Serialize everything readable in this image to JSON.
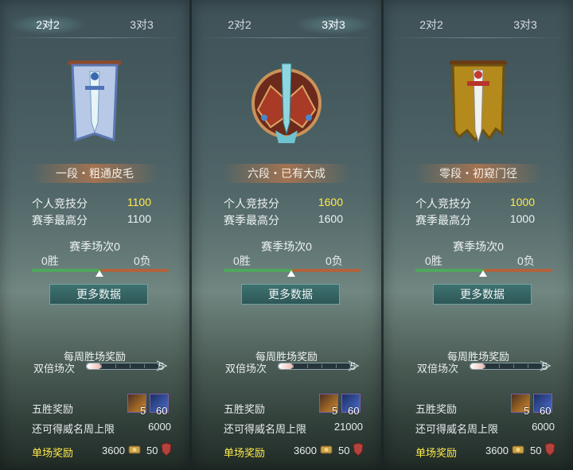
{
  "panels": [
    {
      "tabs": [
        "2对2",
        "3对3"
      ],
      "active_tab": 0,
      "emblem": "blue-banner-sword-icon",
      "rank_title": "一段・粗通皮毛",
      "personal_score_label": "个人竞技分",
      "personal_score": "1100",
      "season_high_label": "赛季最高分",
      "season_high": "1100",
      "season_matches": "赛季场次0",
      "wins": "0胜",
      "losses": "0负",
      "more_button": "更多数据",
      "weekly_reward": "每周胜场奖励",
      "double_label": "双倍场次",
      "double_count": "5",
      "five_win_label": "五胜奖励",
      "item1_count": "5",
      "item2_count": "60",
      "cap_label": "还可得威名周上限",
      "cap_value": "6000",
      "single_label": "单场奖励",
      "single_val1": "3600",
      "single_val2": "50"
    },
    {
      "tabs": [
        "2对2",
        "3对3"
      ],
      "active_tab": 1,
      "emblem": "ornate-crest-sword-icon",
      "rank_title": "六段・已有大成",
      "personal_score_label": "个人竞技分",
      "personal_score": "1600",
      "season_high_label": "赛季最高分",
      "season_high": "1600",
      "season_matches": "赛季场次0",
      "wins": "0胜",
      "losses": "0负",
      "more_button": "更多数据",
      "weekly_reward": "每周胜场奖励",
      "double_label": "双倍场次",
      "double_count": "5",
      "five_win_label": "五胜奖励",
      "item1_count": "5",
      "item2_count": "60",
      "cap_label": "还可得威名周上限",
      "cap_value": "21000",
      "single_label": "单场奖励",
      "single_val1": "3600",
      "single_val2": "50"
    },
    {
      "tabs": [
        "2对2",
        "3对3"
      ],
      "active_tab": -1,
      "emblem": "tattered-gold-banner-sword-icon",
      "rank_title": "零段・初窥门径",
      "personal_score_label": "个人竞技分",
      "personal_score": "1000",
      "season_high_label": "赛季最高分",
      "season_high": "1000",
      "season_matches": "赛季场次0",
      "wins": "0胜",
      "losses": "0负",
      "more_button": "更多数据",
      "weekly_reward": "每周胜场奖励",
      "double_label": "双倍场次",
      "double_count": "5",
      "five_win_label": "五胜奖励",
      "item1_count": "5",
      "item2_count": "60",
      "cap_label": "还可得威名周上限",
      "cap_value": "6000",
      "single_label": "单场奖励",
      "single_val1": "3600",
      "single_val2": "50"
    }
  ],
  "colors": {
    "highlight": "#ffe94a",
    "win_bar": "#4fa85b",
    "loss_bar": "#b2633e",
    "button": "#3f7272"
  }
}
